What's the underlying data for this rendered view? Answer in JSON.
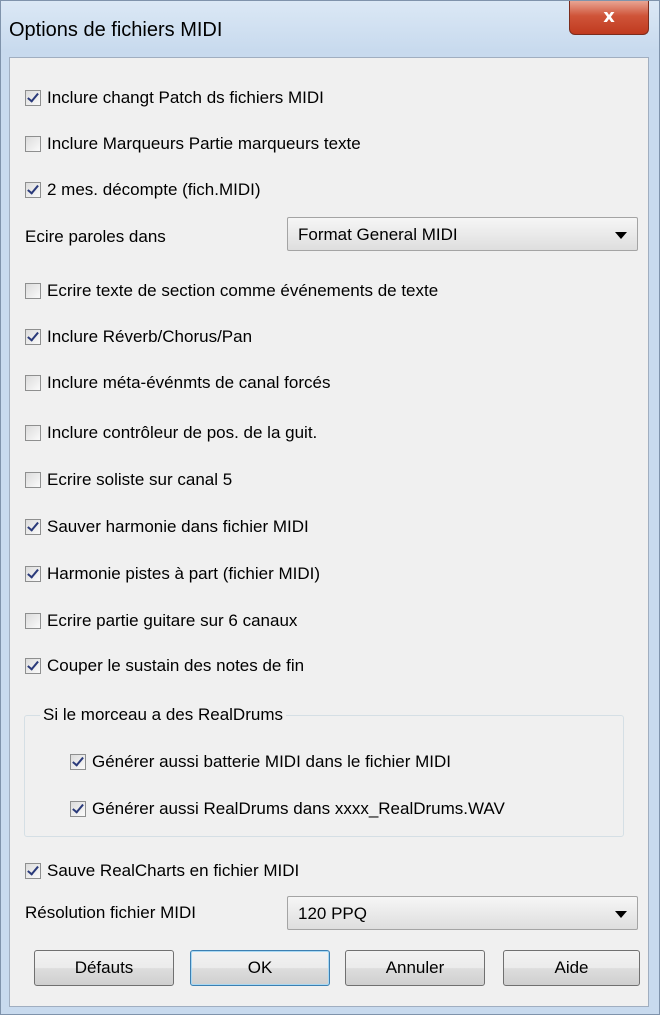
{
  "window": {
    "title": "Options de fichiers MIDI",
    "close_label": "x"
  },
  "options_top": [
    {
      "label": "Inclure changt Patch ds fichiers MIDI",
      "checked": true
    },
    {
      "label": "Inclure Marqueurs Partie marqueurs texte",
      "checked": false
    },
    {
      "label": "2 mes. décompte (fich.MIDI)",
      "checked": true
    }
  ],
  "lyrics": {
    "label": "Ecire paroles dans",
    "value": "Format General MIDI"
  },
  "options_mid": [
    {
      "label": "Ecrire texte de section comme événements de texte",
      "checked": false
    },
    {
      "label": "Inclure Réverb/Chorus/Pan",
      "checked": true
    },
    {
      "label": "Inclure méta-événmts de canal forcés",
      "checked": false
    },
    {
      "label": "Inclure contrôleur de pos. de la guit.",
      "checked": false
    },
    {
      "label": "Ecrire soliste sur canal 5",
      "checked": false
    },
    {
      "label": "Sauver harmonie dans fichier MIDI",
      "checked": true
    },
    {
      "label": "Harmonie pistes à part (fichier MIDI)",
      "checked": true
    },
    {
      "label": "Ecrire partie guitare sur 6 canaux",
      "checked": false
    },
    {
      "label": "Couper le sustain des notes de fin",
      "checked": true
    }
  ],
  "realdrums_group": {
    "title": "Si le morceau a des RealDrums",
    "options": [
      {
        "label": "Générer aussi batterie MIDI dans le fichier MIDI",
        "checked": true
      },
      {
        "label": "Générer aussi RealDrums dans xxxx_RealDrums.WAV",
        "checked": true
      }
    ]
  },
  "realcharts": {
    "label": "Sauve RealCharts en fichier MIDI",
    "checked": true
  },
  "resolution": {
    "label": "Résolution fichier MIDI",
    "value": "120 PPQ"
  },
  "buttons": {
    "defaults": "Défauts",
    "ok": "OK",
    "cancel": "Annuler",
    "help": "Aide"
  }
}
